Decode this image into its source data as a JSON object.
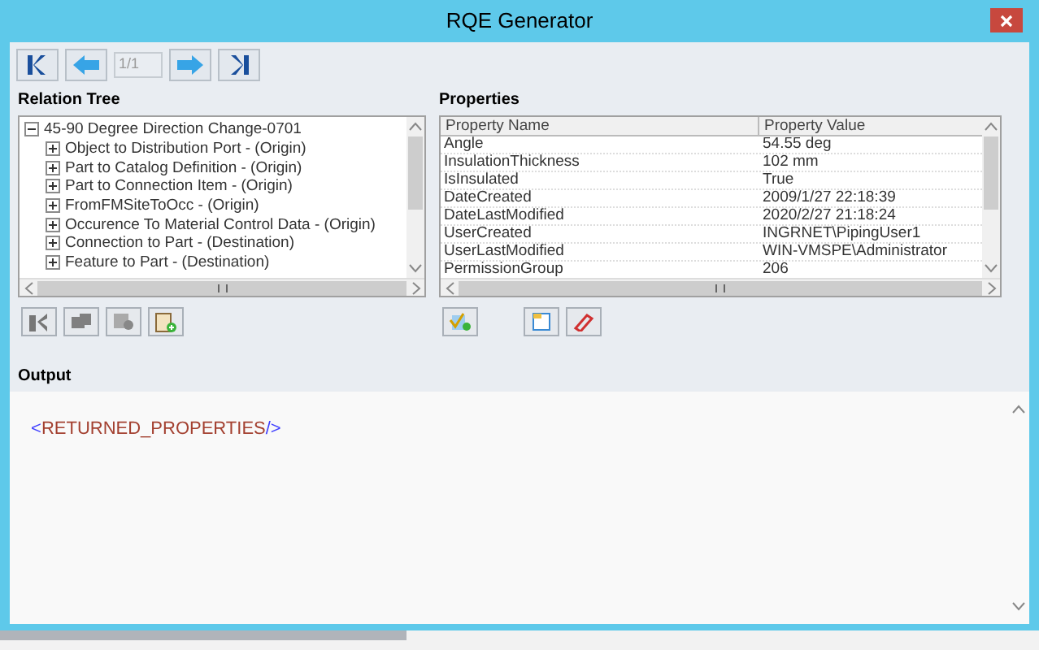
{
  "window": {
    "title": "RQE Generator"
  },
  "navigator": {
    "page": "1/1"
  },
  "relation_tree": {
    "label": "Relation Tree",
    "items": [
      {
        "label": "45-90 Degree Direction Change-0701",
        "expanded": true,
        "children": [
          {
            "label": "Object to Distribution Port - (Origin)",
            "expanded": false
          },
          {
            "label": "Part to Catalog Definition - (Origin)",
            "expanded": false
          },
          {
            "label": "Part to Connection Item - (Origin)",
            "expanded": false
          },
          {
            "label": "FromFMSiteToOcc - (Origin)",
            "expanded": false
          },
          {
            "label": "Occurence To Material Control Data - (Origin)",
            "expanded": false
          },
          {
            "label": "Connection to Part - (Destination)",
            "expanded": false
          },
          {
            "label": "Feature to Part - (Destination)",
            "expanded": false
          }
        ]
      }
    ]
  },
  "properties": {
    "label": "Properties",
    "columns": [
      "Property Name",
      "Property Value"
    ],
    "rows": [
      [
        "Angle",
        "54.55 deg"
      ],
      [
        "InsulationThickness",
        "102 mm"
      ],
      [
        "IsInsulated",
        "True"
      ],
      [
        "DateCreated",
        "2009/1/27 22:18:39"
      ],
      [
        "DateLastModified",
        "2020/2/27 21:18:24"
      ],
      [
        "UserCreated",
        "INGRNET\\PipingUser1"
      ],
      [
        "UserLastModified",
        "WIN-VMSPE\\Administrator"
      ],
      [
        "PermissionGroup",
        "206"
      ]
    ]
  },
  "output": {
    "label": "Output",
    "tokens": [
      {
        "kind": "bracket",
        "text": "<"
      },
      {
        "kind": "name",
        "text": "RETURNED_PROPERTIES"
      },
      {
        "kind": "bracket",
        "text": "/>"
      }
    ]
  }
}
